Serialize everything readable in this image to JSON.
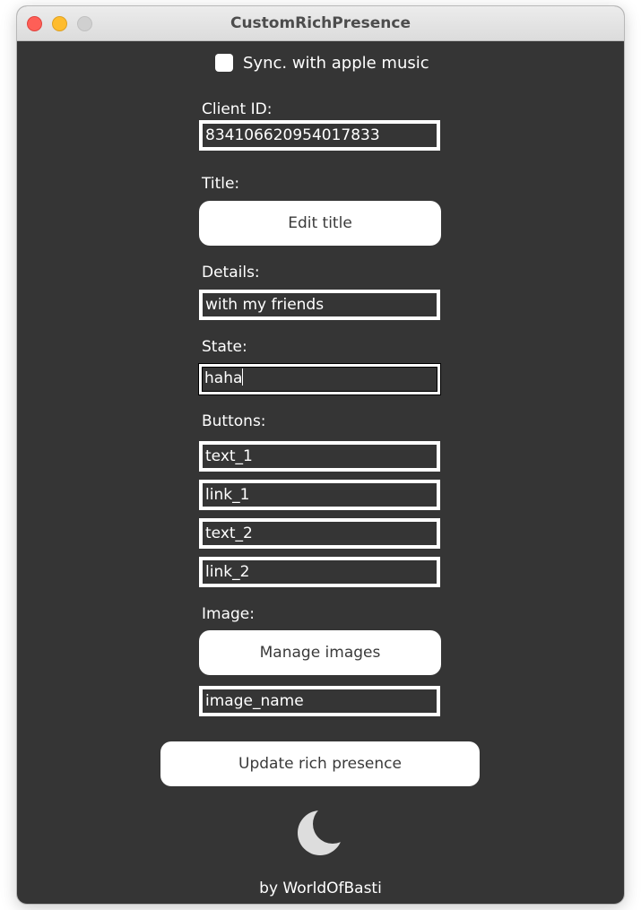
{
  "window": {
    "title": "CustomRichPresence"
  },
  "sync": {
    "label": "Sync. with apple music",
    "checked": false
  },
  "client_id": {
    "label": "Client ID:",
    "value": "834106620954017833"
  },
  "title_section": {
    "label": "Title:",
    "button_label": "Edit title"
  },
  "details": {
    "label": "Details:",
    "value": "with my friends"
  },
  "state": {
    "label": "State:",
    "value": "haha"
  },
  "buttons_section": {
    "label": "Buttons:",
    "fields": [
      {
        "value": "text_1"
      },
      {
        "value": "link_1"
      },
      {
        "value": "text_2"
      },
      {
        "value": "link_2"
      }
    ]
  },
  "image_section": {
    "label": "Image:",
    "button_label": "Manage images",
    "image_name": "image_name"
  },
  "update_button": {
    "label": "Update rich presence"
  },
  "theme_icon": "moon-icon",
  "footer": {
    "text": "by WorldOfBasti"
  },
  "colors": {
    "background": "#353535",
    "text": "#ffffff",
    "button_bg": "#ffffff",
    "button_text": "#3a3a3a",
    "close": "#fe5f57",
    "minimize": "#febc2e",
    "zoom": "#d0d0d0",
    "moon": "#dddddd"
  }
}
